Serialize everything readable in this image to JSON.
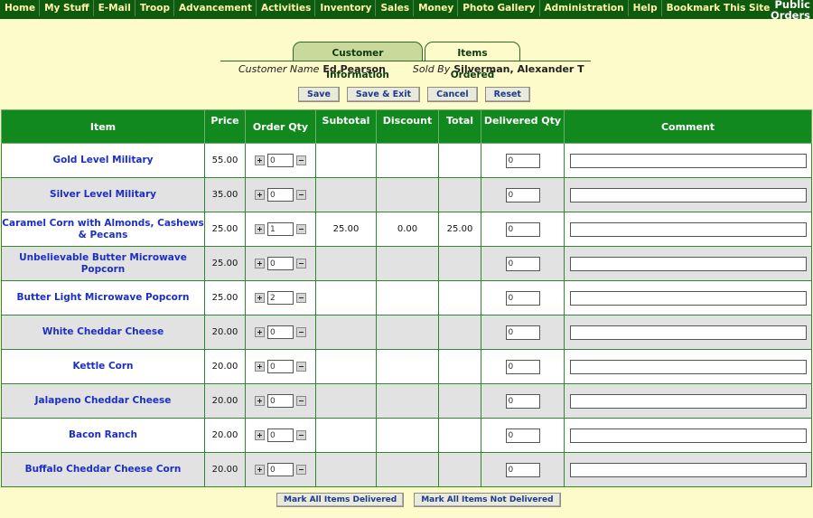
{
  "nav": {
    "items": [
      "Home",
      "My Stuff",
      "E-Mail",
      "Troop",
      "Advancement",
      "Activities",
      "Inventory",
      "Sales",
      "Money",
      "Photo Gallery",
      "Administration",
      "Help",
      "Bookmark This Site"
    ],
    "public_orders_line1": "Public",
    "public_orders_line2": "Orders"
  },
  "tabs": {
    "customer_info": "Customer Information",
    "items_ordered": "Items Ordered"
  },
  "customer": {
    "name_label": "Customer Name",
    "name_value": "Ed Pearson",
    "sold_by_label": "Sold By",
    "sold_by_value": "Silverman, Alexander T"
  },
  "actions": {
    "save": "Save",
    "save_exit": "Save & Exit",
    "cancel": "Cancel",
    "reset": "Reset"
  },
  "table": {
    "headers": {
      "item": "Item",
      "price": "Price",
      "order_qty": "Order Qty",
      "subtotal": "Subtotal",
      "discount": "Discount",
      "total": "Total",
      "delivered_qty": "Delivered Qty",
      "comment": "Comment"
    },
    "rows": [
      {
        "item": "Gold Level Military",
        "price": "55.00",
        "qty": "0",
        "subtotal": "",
        "discount": "",
        "total": "",
        "delivered": "0",
        "comment": ""
      },
      {
        "item": "Silver Level Military",
        "price": "35.00",
        "qty": "0",
        "subtotal": "",
        "discount": "",
        "total": "",
        "delivered": "0",
        "comment": ""
      },
      {
        "item": "Caramel Corn with Almonds, Cashews & Pecans",
        "price": "25.00",
        "qty": "1",
        "subtotal": "25.00",
        "discount": "0.00",
        "total": "25.00",
        "delivered": "0",
        "comment": ""
      },
      {
        "item": "Unbelievable Butter Microwave Popcorn",
        "price": "25.00",
        "qty": "0",
        "subtotal": "",
        "discount": "",
        "total": "",
        "delivered": "0",
        "comment": ""
      },
      {
        "item": "Butter Light Microwave Popcorn",
        "price": "25.00",
        "qty": "2",
        "subtotal": "",
        "discount": "",
        "total": "",
        "delivered": "0",
        "comment": ""
      },
      {
        "item": "White Cheddar Cheese",
        "price": "20.00",
        "qty": "0",
        "subtotal": "",
        "discount": "",
        "total": "",
        "delivered": "0",
        "comment": ""
      },
      {
        "item": "Kettle Corn",
        "price": "20.00",
        "qty": "0",
        "subtotal": "",
        "discount": "",
        "total": "",
        "delivered": "0",
        "comment": ""
      },
      {
        "item": "Jalapeno Cheddar Cheese",
        "price": "20.00",
        "qty": "0",
        "subtotal": "",
        "discount": "",
        "total": "",
        "delivered": "0",
        "comment": ""
      },
      {
        "item": "Bacon Ranch",
        "price": "20.00",
        "qty": "0",
        "subtotal": "",
        "discount": "",
        "total": "",
        "delivered": "0",
        "comment": ""
      },
      {
        "item": "Buffalo Cheddar Cheese Corn",
        "price": "20.00",
        "qty": "0",
        "subtotal": "",
        "discount": "",
        "total": "",
        "delivered": "0",
        "comment": ""
      }
    ]
  },
  "bottom": {
    "mark_all_delivered": "Mark All Items Delivered",
    "mark_all_not_delivered": "Mark All Items Not Delivered"
  },
  "colors": {
    "nav_bg": "#0e5a0e",
    "page_bg": "#fdfbc9",
    "header_bg": "#12891e",
    "item_link": "#1d2fc2"
  }
}
